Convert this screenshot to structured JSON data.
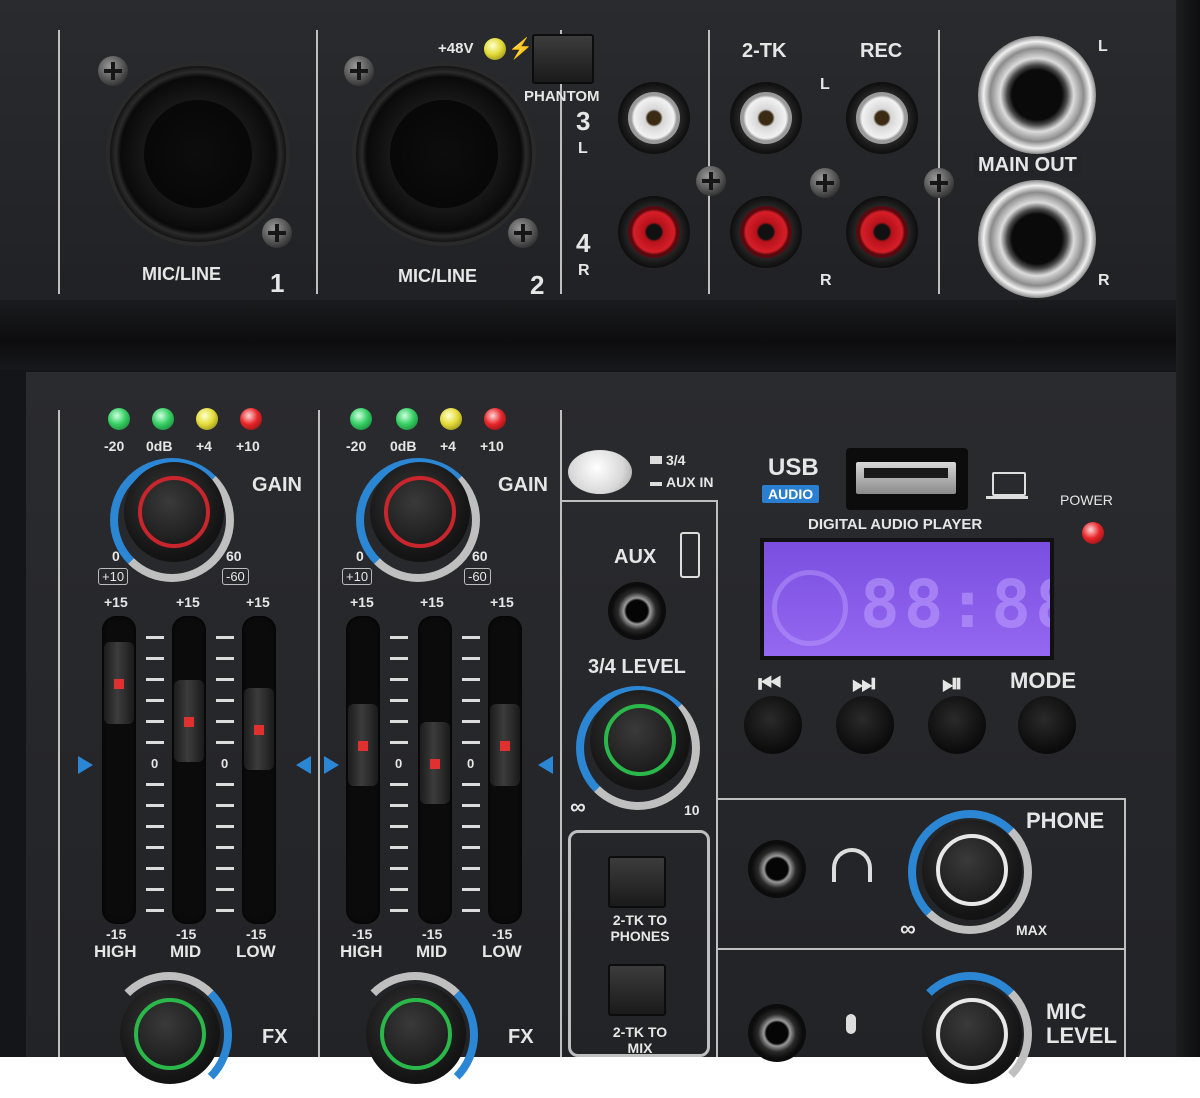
{
  "rear_panel": {
    "phantom_voltage": "+48V",
    "phantom_button": "PHANTOM",
    "ch1_label": "MIC/LINE",
    "ch1_num": "1",
    "ch2_label": "MIC/LINE",
    "ch2_num": "2",
    "ch3_num": "3",
    "ch3_side": "L",
    "ch4_num": "4",
    "ch4_side": "R",
    "twotk_label": "2-TK",
    "rec_label": "REC",
    "left_marker": "L",
    "right_marker": "R",
    "main_out_label": "MAIN OUT",
    "main_out_l": "L",
    "main_out_r": "R"
  },
  "channels": [
    {
      "meter": [
        "-20",
        "0dB",
        "+4",
        "+10"
      ],
      "gain_label": "GAIN",
      "gain_min": "0",
      "gain_max": "60",
      "gain_min_line": "+10",
      "gain_max_line": "-60",
      "eq_top": [
        "+15",
        "+15",
        "+15"
      ],
      "eq_bottom": [
        "-15",
        "-15",
        "-15"
      ],
      "eq_names": [
        "HIGH",
        "MID",
        "LOW"
      ],
      "eq_zero": "0",
      "fx_label": "FX"
    },
    {
      "meter": [
        "-20",
        "0dB",
        "+4",
        "+10"
      ],
      "gain_label": "GAIN",
      "gain_min": "0",
      "gain_max": "60",
      "gain_min_line": "+10",
      "gain_max_line": "-60",
      "eq_top": [
        "+15",
        "+15",
        "+15"
      ],
      "eq_bottom": [
        "-15",
        "-15",
        "-15"
      ],
      "eq_names": [
        "HIGH",
        "MID",
        "LOW"
      ],
      "eq_zero": "0",
      "fx_label": "FX"
    }
  ],
  "center": {
    "switch_up": "3/4",
    "switch_down": "AUX IN",
    "aux_label": "AUX",
    "level_label": "3/4 LEVEL",
    "level_min": "∞",
    "level_max": "10",
    "btn1": "2-TK TO PHONES",
    "btn2": "2-TK TO MIX"
  },
  "player": {
    "usb": "USB",
    "usb_sub": "AUDIO",
    "title": "DIGITAL AUDIO PLAYER",
    "power": "POWER",
    "controls": [
      "⏮",
      "⏭",
      "⏯",
      "MODE"
    ],
    "lcd_digits": "88:88"
  },
  "phones": {
    "label": "PHONE",
    "min": "∞",
    "max": "MAX",
    "mic_label": "MIC LEVEL"
  },
  "colors": {
    "panel": "#232428",
    "gain_ring": "#c8262c",
    "fx_ring": "#2bb84a",
    "accent_blue": "#2b86d3",
    "lcd": "#8a5cf0"
  }
}
